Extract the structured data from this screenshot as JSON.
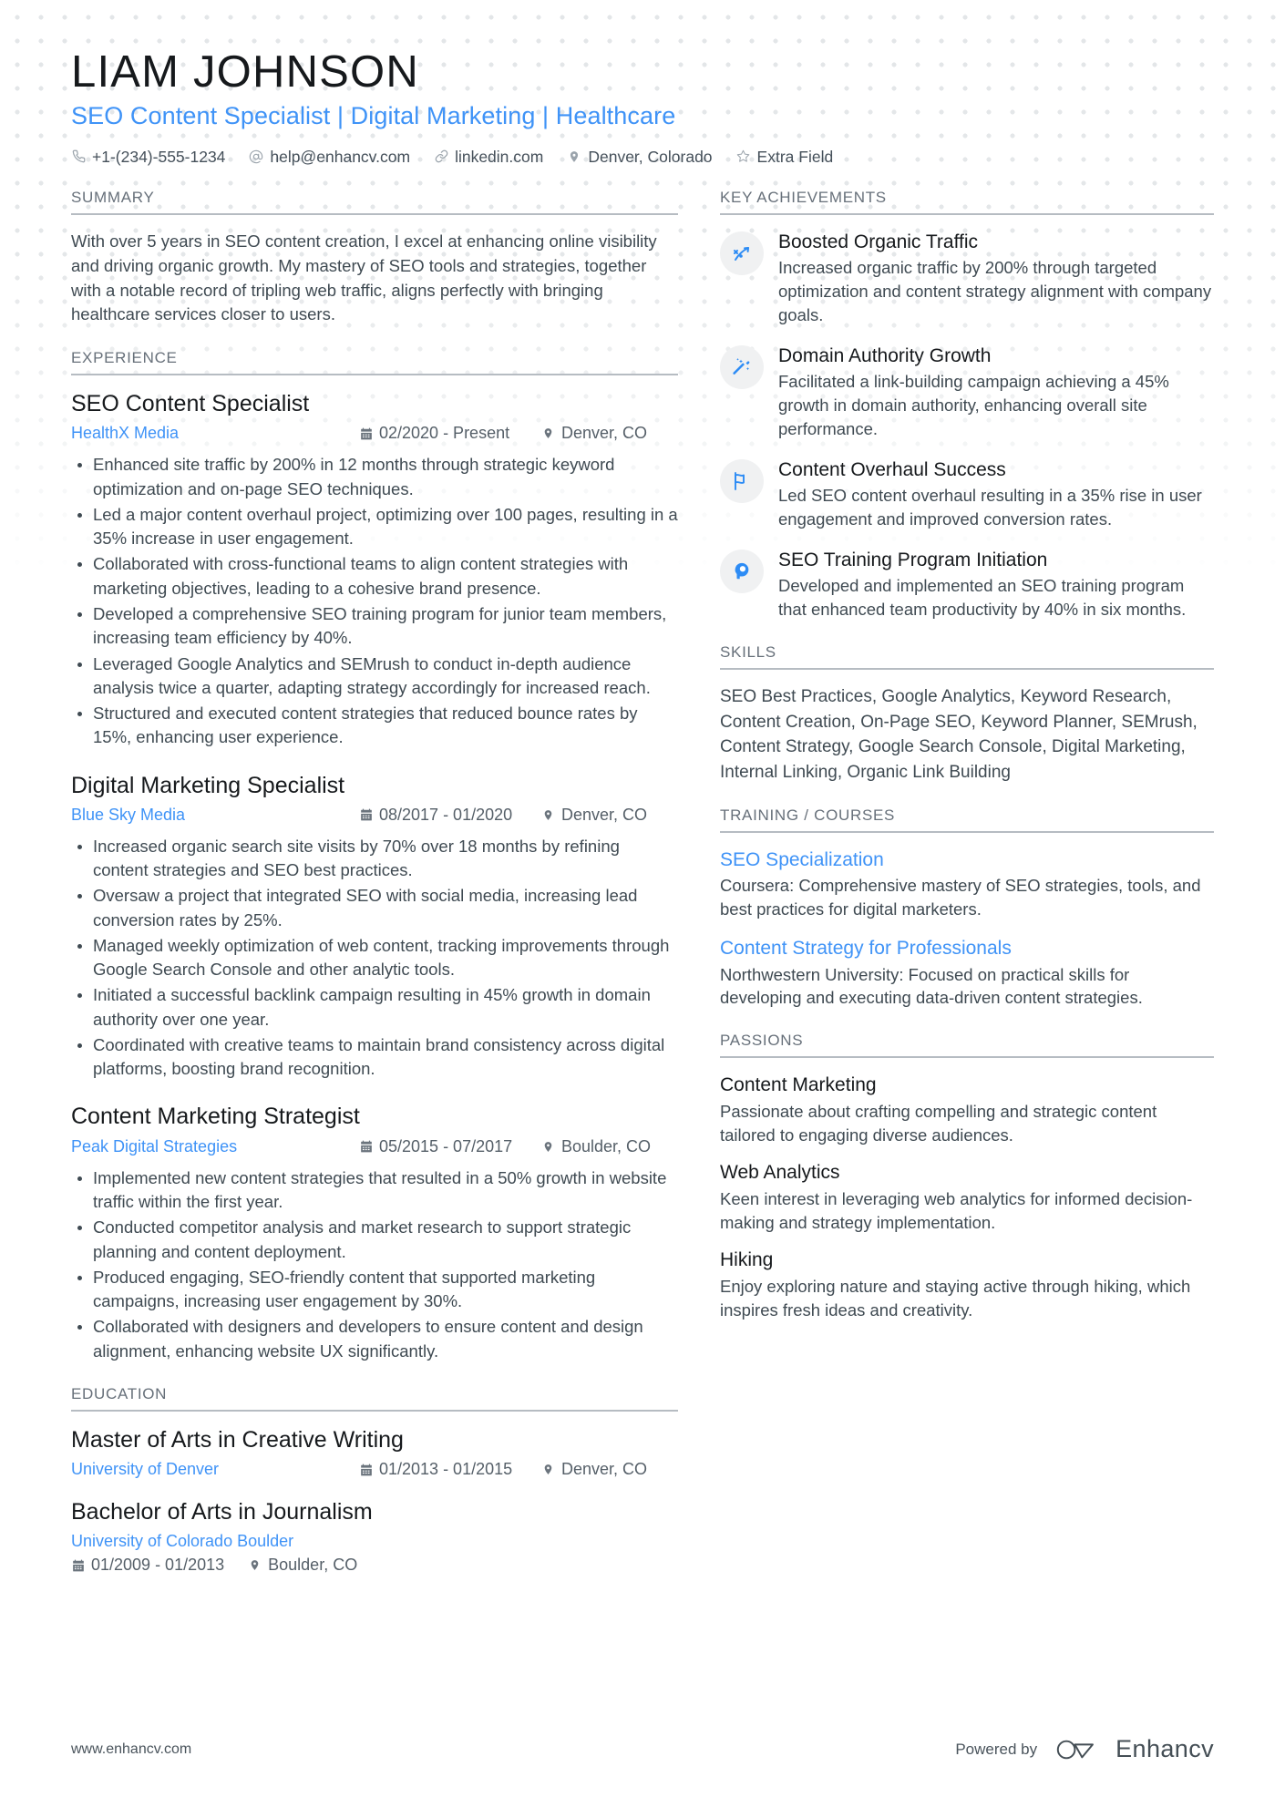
{
  "header": {
    "name": "LIAM JOHNSON",
    "headline": "SEO Content Specialist | Digital Marketing | Healthcare",
    "contacts": [
      {
        "icon": "phone-icon",
        "text": "+1-(234)-555-1234"
      },
      {
        "icon": "email-icon",
        "text": "help@enhancv.com"
      },
      {
        "icon": "link-icon",
        "text": "linkedin.com"
      },
      {
        "icon": "location-pin-icon",
        "text": "Denver, Colorado"
      },
      {
        "icon": "star-icon",
        "text": "Extra Field"
      }
    ]
  },
  "summary": {
    "title": "SUMMARY",
    "text": "With over 5 years in SEO content creation, I excel at enhancing online visibility and driving organic growth. My mastery of SEO tools and strategies, together with a notable record of tripling web traffic, aligns perfectly with bringing healthcare services closer to users."
  },
  "experience": {
    "title": "EXPERIENCE",
    "entries": [
      {
        "role": "SEO Content Specialist",
        "company": "HealthX Media",
        "dates": "02/2020 - Present",
        "location": "Denver, CO",
        "bullets": [
          "Enhanced site traffic by 200% in 12 months through strategic keyword optimization and on-page SEO techniques.",
          "Led a major content overhaul project, optimizing over 100 pages, resulting in a 35% increase in user engagement.",
          "Collaborated with cross-functional teams to align content strategies with marketing objectives, leading to a cohesive brand presence.",
          "Developed a comprehensive SEO training program for junior team members, increasing team efficiency by 40%.",
          "Leveraged Google Analytics and SEMrush to conduct in-depth audience analysis twice a quarter, adapting strategy accordingly for increased reach.",
          "Structured and executed content strategies that reduced bounce rates by 15%, enhancing user experience."
        ]
      },
      {
        "role": "Digital Marketing Specialist",
        "company": "Blue Sky Media",
        "dates": "08/2017 - 01/2020",
        "location": "Denver, CO",
        "bullets": [
          "Increased organic search site visits by 70% over 18 months by refining content strategies and SEO best practices.",
          "Oversaw a project that integrated SEO with social media, increasing lead conversion rates by 25%.",
          "Managed weekly optimization of web content, tracking improvements through Google Search Console and other analytic tools.",
          "Initiated a successful backlink campaign resulting in 45% growth in domain authority over one year.",
          "Coordinated with creative teams to maintain brand consistency across digital platforms, boosting brand recognition."
        ]
      },
      {
        "role": "Content Marketing Strategist",
        "company": "Peak Digital Strategies",
        "dates": "05/2015 - 07/2017",
        "location": "Boulder, CO",
        "bullets": [
          "Implemented new content strategies that resulted in a 50% growth in website traffic within the first year.",
          "Conducted competitor analysis and market research to support strategic planning and content deployment.",
          "Produced engaging, SEO-friendly content that supported marketing campaigns, increasing user engagement by 30%.",
          "Collaborated with designers and developers to ensure content and design alignment, enhancing website UX significantly."
        ]
      }
    ]
  },
  "education": {
    "title": "EDUCATION",
    "entries": [
      {
        "degree": "Master of Arts in Creative Writing",
        "school": "University of Denver",
        "dates": "01/2013 - 01/2015",
        "location": "Denver, CO",
        "inline": true
      },
      {
        "degree": "Bachelor of Arts in Journalism",
        "school": "University of Colorado Boulder",
        "dates": "01/2009 - 01/2013",
        "location": "Boulder, CO",
        "inline": false
      }
    ]
  },
  "achievements": {
    "title": "KEY ACHIEVEMENTS",
    "items": [
      {
        "icon": "rocket-trajectory-icon",
        "title": "Boosted Organic Traffic",
        "desc": "Increased organic traffic by 200% through targeted optimization and content strategy alignment with company goals."
      },
      {
        "icon": "magic-wand-icon",
        "title": "Domain Authority Growth",
        "desc": "Facilitated a link-building campaign achieving a 45% growth in domain authority, enhancing overall site performance."
      },
      {
        "icon": "flag-icon",
        "title": "Content Overhaul Success",
        "desc": "Led SEO content overhaul resulting in a 35% rise in user engagement and improved conversion rates."
      },
      {
        "icon": "head-idea-icon",
        "title": "SEO Training Program Initiation",
        "desc": "Developed and implemented an SEO training program that enhanced team productivity by 40% in six months."
      }
    ]
  },
  "skills": {
    "title": "SKILLS",
    "text": "SEO Best Practices, Google Analytics, Keyword Research, Content Creation, On-Page SEO, Keyword Planner, SEMrush, Content Strategy, Google Search Console, Digital Marketing, Internal Linking, Organic Link Building"
  },
  "training": {
    "title": "TRAINING / COURSES",
    "courses": [
      {
        "name": "SEO Specialization",
        "desc": "Coursera: Comprehensive mastery of SEO strategies, tools, and best practices for digital marketers."
      },
      {
        "name": "Content Strategy for Professionals",
        "desc": "Northwestern University: Focused on practical skills for developing and executing data-driven content strategies."
      }
    ]
  },
  "passions": {
    "title": "PASSIONS",
    "items": [
      {
        "name": "Content Marketing",
        "desc": "Passionate about crafting compelling and strategic content tailored to engaging diverse audiences."
      },
      {
        "name": "Web Analytics",
        "desc": "Keen interest in leveraging web analytics for informed decision-making and strategy implementation."
      },
      {
        "name": "Hiking",
        "desc": "Enjoy exploring nature and staying active through hiking, which inspires fresh ideas and creativity."
      }
    ]
  },
  "footer": {
    "url": "www.enhancv.com",
    "powered_by": "Powered by",
    "brand": "Enhancv"
  },
  "colors": {
    "accent": "#3f93f7",
    "text": "#3f4a52",
    "heading": "#16191c",
    "muted": "#67707a",
    "rule": "#b6bcc2",
    "icon_bg": "#f0f1f2"
  }
}
